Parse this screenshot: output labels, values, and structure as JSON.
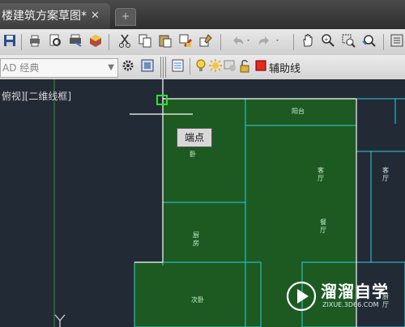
{
  "tab": {
    "title": "楼建筑方案草图*",
    "close": "✕"
  },
  "toolbar": {
    "icons": [
      "save-icon",
      "print-icon",
      "print-preview-icon",
      "plot-icon",
      "publish-3d-icon",
      "cut-icon",
      "copy-icon",
      "paste-icon",
      "match-properties-icon",
      "block-editor-icon",
      "undo-icon",
      "redo-icon",
      "pan-icon",
      "zoom-realtime-icon",
      "zoom-window-icon",
      "zoom-previous-icon"
    ]
  },
  "workspace": {
    "value": "AD 经典"
  },
  "layer": {
    "name": "辅助线",
    "color": "#e8291c"
  },
  "viewport": {
    "label": "俯视][二维线框]"
  },
  "tooltip": {
    "text": "端点"
  },
  "rooms": [
    {
      "id": "balcony",
      "text": "阳台"
    },
    {
      "id": "bedroom",
      "text": "卧"
    },
    {
      "id": "living-1",
      "text": "客\n厅"
    },
    {
      "id": "kitchen",
      "text": "厨\n房"
    },
    {
      "id": "dining",
      "text": "餐\n厅"
    },
    {
      "id": "second-bedroom",
      "text": "次卧"
    },
    {
      "id": "living-2",
      "text": "客\n厅"
    },
    {
      "id": "dining-2",
      "text": "厨\n厅"
    }
  ],
  "watermark": {
    "title": "溜溜自学",
    "subtitle": "ZIXUE.3D66.COM"
  },
  "colors": {
    "fill": "#1c5a22",
    "line": "#2ad0d6",
    "wall": "#ffffff",
    "canvas": "#222a36"
  }
}
